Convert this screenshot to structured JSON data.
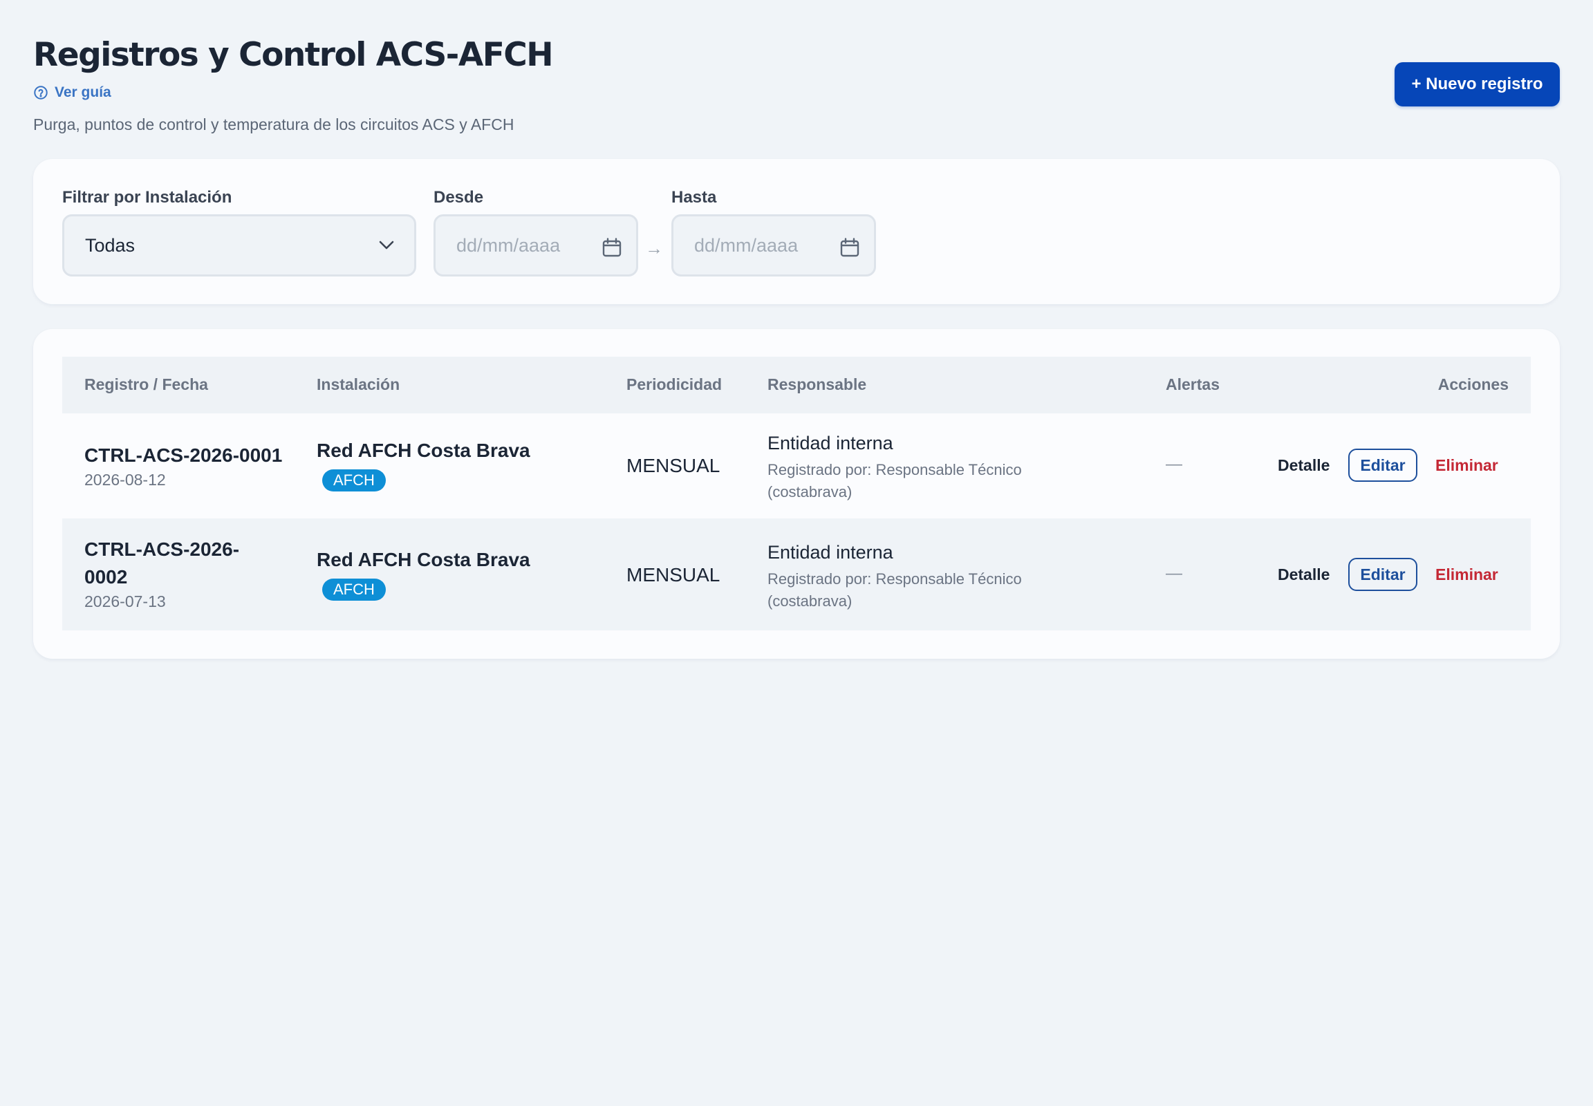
{
  "header": {
    "title": "Registros y Control ACS-AFCH",
    "guide_label": "Ver guía",
    "subtitle": "Purga, puntos de control y temperatura de los circuitos ACS y AFCH",
    "new_button_label": "+ Nuevo registro"
  },
  "filters": {
    "installation_label": "Filtrar por Instalación",
    "installation_value": "Todas",
    "from_label": "Desde",
    "from_placeholder": "dd/mm/aaaa",
    "to_label": "Hasta",
    "to_placeholder": "dd/mm/aaaa",
    "range_separator": "→"
  },
  "table": {
    "columns": [
      "Registro / Fecha",
      "Instalación",
      "Periodicidad",
      "Responsable",
      "Alertas",
      "Acciones"
    ],
    "rows": [
      {
        "code_line1": "CTRL-ACS-2026-0001",
        "code_line2": "",
        "date": "2026-08-12",
        "installation": "Red AFCH Costa Brava",
        "badge": "AFCH",
        "periodicity": "MENSUAL",
        "responsible": "Entidad interna",
        "registered_by": "Registrado por: Responsable Técnico (costabrava)",
        "alerts": "—",
        "detail_label": "Detalle",
        "edit_label": "Editar",
        "delete_label": "Eliminar"
      },
      {
        "code_line1": "CTRL-ACS-2026-",
        "code_line2": "0002",
        "date": "2026-07-13",
        "installation": "Red AFCH Costa Brava",
        "badge": "AFCH",
        "periodicity": "MENSUAL",
        "responsible": "Entidad interna",
        "registered_by": "Registrado por: Responsable Técnico (costabrava)",
        "alerts": "—",
        "detail_label": "Detalle",
        "edit_label": "Editar",
        "delete_label": "Eliminar"
      }
    ]
  },
  "colors": {
    "primary": "#0646b8",
    "badge": "#0e8fd6",
    "danger": "#c42835",
    "background": "#f0f4f8"
  },
  "icons": {
    "guide": "help-circle-icon",
    "select": "chevron-down-icon",
    "date": "calendar-icon"
  }
}
